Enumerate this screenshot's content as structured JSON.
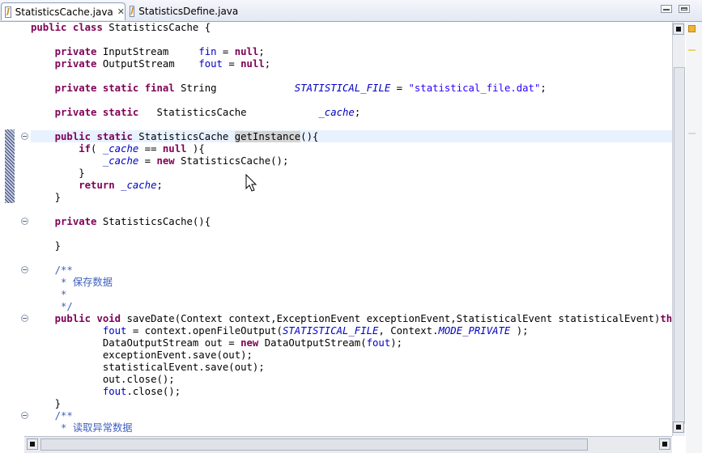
{
  "tabs": [
    {
      "label": "StatisticsCache.java",
      "active": true,
      "icon": "java-file-icon"
    },
    {
      "label": "StatisticsDefine.java",
      "active": false,
      "icon": "java-file-icon"
    }
  ],
  "editor": {
    "file": "StatisticsCache.java",
    "lines": [
      "public class StatisticsCache {",
      "",
      "    private InputStream     fin = null;",
      "    private OutputStream    fout = null;",
      "",
      "    private static final String             STATISTICAL_FILE = \"statistical_file.dat\";",
      "",
      "    private static   StatisticsCache            _cache;",
      "",
      "    public static StatisticsCache getInstance(){",
      "        if( _cache == null ){",
      "            _cache = new StatisticsCache();",
      "        }",
      "        return _cache;",
      "    }",
      "",
      "    private StatisticsCache(){",
      "",
      "    }",
      "",
      "    /**",
      "     * 保存数据",
      "     *",
      "     */",
      "    public void saveDate(Context context,ExceptionEvent exceptionEvent,StatisticalEvent statisticalEvent)throws IOException{",
      "            fout = context.openFileOutput(STATISTICAL_FILE, Context.MODE_PRIVATE );",
      "            DataOutputStream out = new DataOutputStream(fout);",
      "            exceptionEvent.save(out);",
      "            statisticalEvent.save(out);",
      "            out.close();",
      "            fout.close();",
      "    }",
      "    /**",
      "     * 读取异常数据"
    ]
  },
  "colors": {
    "keyword": "#7f0055",
    "field": "#0000c0",
    "string": "#2a00ff",
    "comment": "#3f5fbf",
    "current_line": "#e8f2fe",
    "occurrence_highlight": "#d4d4d4"
  }
}
